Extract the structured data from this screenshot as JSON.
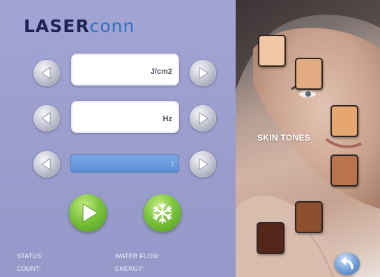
{
  "brand": {
    "part1": "LASER",
    "part2": "conn"
  },
  "fields": {
    "fluence_unit": "J/cm2",
    "frequency_unit": "Hz",
    "energy_unit": "J"
  },
  "status_labels": {
    "status": "STATUS:",
    "water_flow": "WATER FLOW:",
    "count": "COUNT:",
    "energy": "ENERGY:"
  },
  "skin_panel": {
    "title": "SKIN TONES"
  },
  "skin_tones": [
    {
      "color": "#f1c7a6"
    },
    {
      "color": "#e3ab82"
    },
    {
      "color": "#e5a670"
    },
    {
      "color": "#b9734d"
    },
    {
      "color": "#8e4f2e"
    },
    {
      "color": "#55271a"
    }
  ],
  "colors": {
    "panel_bg": "#9da0cf",
    "accent_blue": "#5c8fd6",
    "accent_green": "#7cc43e"
  },
  "icons": [
    "left-arrow-icon",
    "right-arrow-icon",
    "play-icon",
    "snowflake-icon",
    "back-arrow-icon"
  ]
}
